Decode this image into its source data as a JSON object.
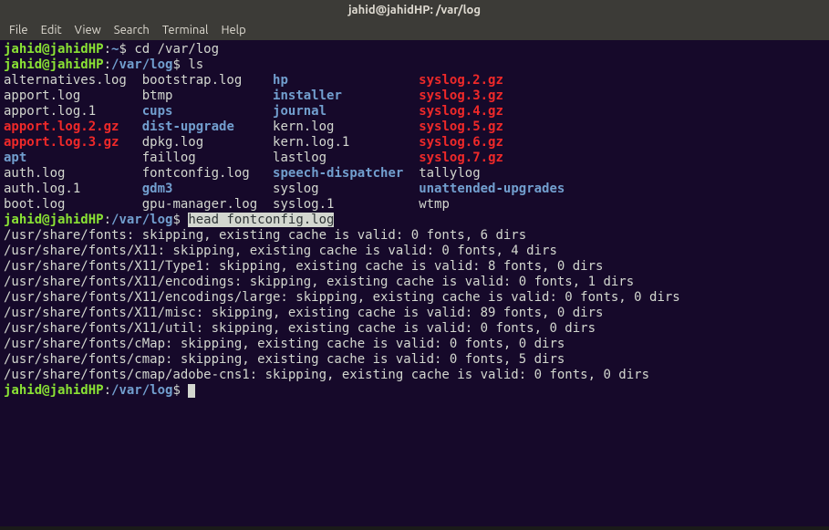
{
  "titlebar": "jahid@jahidHP: /var/log",
  "menu": {
    "file": "File",
    "edit": "Edit",
    "view": "View",
    "search": "Search",
    "terminal": "Terminal",
    "help": "Help"
  },
  "p1": {
    "user": "jahid@jahidHP",
    "colon": ":",
    "path": "~",
    "dollar": "$ ",
    "cmd": "cd /var/log"
  },
  "p2": {
    "user": "jahid@jahidHP",
    "colon": ":",
    "path": "/var/log",
    "dollar": "$ ",
    "cmd": "ls"
  },
  "ls": {
    "r0c0": "alternatives.log",
    "r0c1": "bootstrap.log",
    "r0c2": "hp",
    "r0c3": "syslog.2.gz",
    "r1c0": "apport.log",
    "r1c1": "btmp",
    "r1c2": "installer",
    "r1c3": "syslog.3.gz",
    "r2c0": "apport.log.1",
    "r2c1": "cups",
    "r2c2": "journal",
    "r2c3": "syslog.4.gz",
    "r3c0": "apport.log.2.gz",
    "r3c1": "dist-upgrade",
    "r3c2": "kern.log",
    "r3c3": "syslog.5.gz",
    "r4c0": "apport.log.3.gz",
    "r4c1": "dpkg.log",
    "r4c2": "kern.log.1",
    "r4c3": "syslog.6.gz",
    "r5c0": "apt",
    "r5c1": "faillog",
    "r5c2": "lastlog",
    "r5c3": "syslog.7.gz",
    "r6c0": "auth.log",
    "r6c1": "fontconfig.log",
    "r6c2": "speech-dispatcher",
    "r6c3": "tallylog",
    "r7c0": "auth.log.1",
    "r7c1": "gdm3",
    "r7c2": "syslog",
    "r7c3": "unattended-upgrades",
    "r8c0": "boot.log",
    "r8c1": "gpu-manager.log",
    "r8c2": "syslog.1",
    "r8c3": "wtmp"
  },
  "p3": {
    "user": "jahid@jahidHP",
    "colon": ":",
    "path": "/var/log",
    "dollar": "$ ",
    "cmd": "head fontconfig.log"
  },
  "out": {
    "l0": "/usr/share/fonts: skipping, existing cache is valid: 0 fonts, 6 dirs",
    "l1": "/usr/share/fonts/X11: skipping, existing cache is valid: 0 fonts, 4 dirs",
    "l2": "/usr/share/fonts/X11/Type1: skipping, existing cache is valid: 8 fonts, 0 dirs",
    "l3": "/usr/share/fonts/X11/encodings: skipping, existing cache is valid: 0 fonts, 1 dirs",
    "l4": "/usr/share/fonts/X11/encodings/large: skipping, existing cache is valid: 0 fonts, 0 dirs",
    "l5": "/usr/share/fonts/X11/misc: skipping, existing cache is valid: 89 fonts, 0 dirs",
    "l6": "/usr/share/fonts/X11/util: skipping, existing cache is valid: 0 fonts, 0 dirs",
    "l7": "/usr/share/fonts/cMap: skipping, existing cache is valid: 0 fonts, 0 dirs",
    "l8": "/usr/share/fonts/cmap: skipping, existing cache is valid: 0 fonts, 5 dirs",
    "l9": "/usr/share/fonts/cmap/adobe-cns1: skipping, existing cache is valid: 0 fonts, 0 dirs"
  },
  "p4": {
    "user": "jahid@jahidHP",
    "colon": ":",
    "path": "/var/log",
    "dollar": "$ "
  }
}
